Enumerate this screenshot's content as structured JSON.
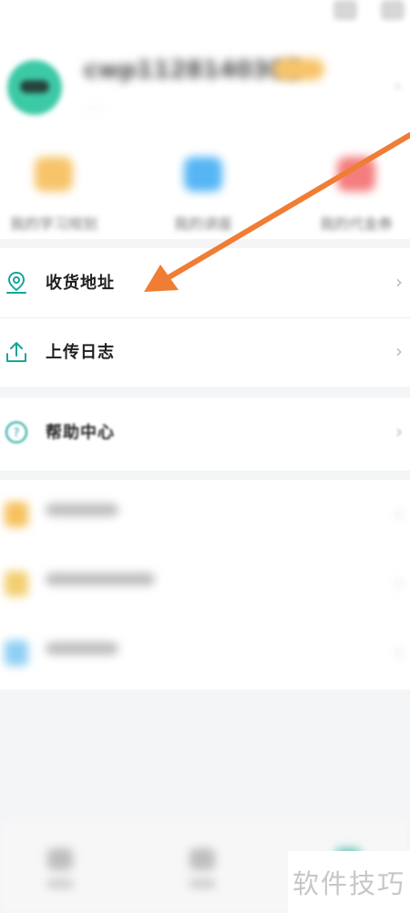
{
  "header": {
    "username": "cwp1128140303",
    "sub_tag": "· · ·"
  },
  "quick_actions": [
    {
      "label": "我的学习规划",
      "icon": "study-plan-icon",
      "color": "#f7c46a"
    },
    {
      "label": "我的讲座",
      "icon": "lecture-icon",
      "color": "#56b6f5"
    },
    {
      "label": "我的代金券",
      "icon": "coupon-icon",
      "color": "#f47d7d"
    }
  ],
  "menu_section_1": [
    {
      "label": "收货地址",
      "icon": "location-pin-icon"
    },
    {
      "label": "上传日志",
      "icon": "upload-icon"
    }
  ],
  "menu_section_2": [
    {
      "label": "帮助中心",
      "icon": "help-icon"
    }
  ],
  "menu_section_3": [
    {
      "icon": "star-icon",
      "color": "#f6c15e"
    },
    {
      "icon": "pencil-icon",
      "color": "#f2cf71"
    },
    {
      "icon": "settings-icon",
      "color": "#8fd0f3"
    }
  ],
  "colors": {
    "accent_teal": "#1aa59a",
    "arrow_orange": "#f07d34"
  },
  "watermark": "软件技巧",
  "chevron": "›"
}
